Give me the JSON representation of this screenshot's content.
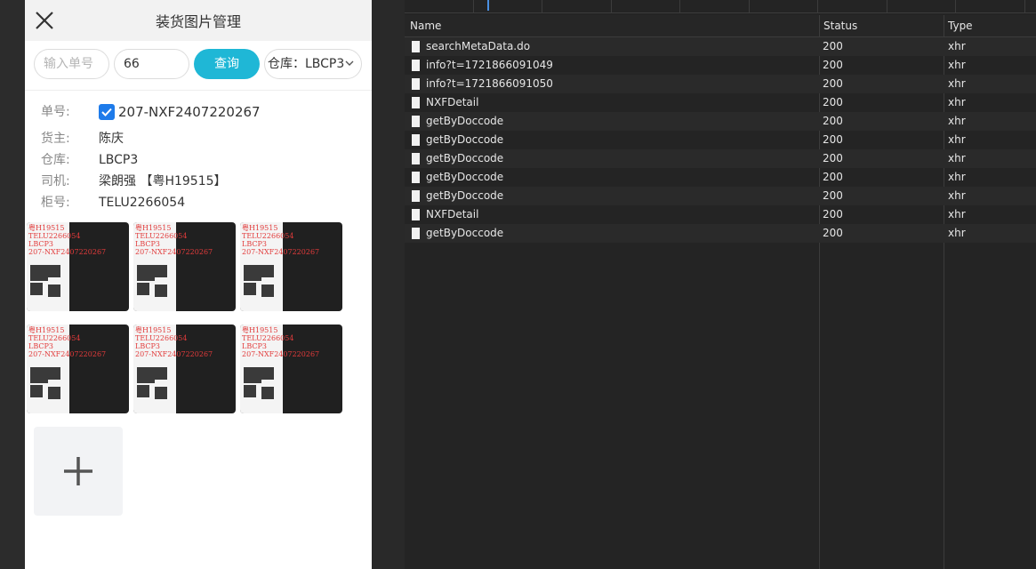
{
  "mobile": {
    "header_title": "装货图片管理",
    "search": {
      "order_placeholder": "输入单号",
      "number_value": "66",
      "query_label": "查询",
      "warehouse_selected": "仓库：LBCP3"
    },
    "details": {
      "order_label": "单号:",
      "order_value": "207-NXF2407220267",
      "owner_label": "货主:",
      "owner_value": "陈庆",
      "warehouse_label": "仓库:",
      "warehouse_value": "LBCP3",
      "driver_label": "司机:",
      "driver_value": "梁朗强 【粤H19515】",
      "container_label": "柜号:",
      "container_value": "TELU2266054"
    },
    "photos": [
      {
        "watermark": [
          "粤H19515",
          "TELU2266054",
          "LBCP3",
          "207-NXF2407220267"
        ]
      },
      {
        "watermark": [
          "粤H19515",
          "TELU2266054",
          "LBCP3",
          "207-NXF2407220267"
        ]
      },
      {
        "watermark": [
          "粤H19515",
          "TELU2266054",
          "LBCP3",
          "207-NXF2407220267"
        ]
      },
      {
        "watermark": [
          "粤H19515",
          "TELU2266054",
          "LBCP3",
          "207-NXF2407220267"
        ]
      },
      {
        "watermark": [
          "粤H19515",
          "TELU2266054",
          "LBCP3",
          "207-NXF2407220267"
        ]
      },
      {
        "watermark": [
          "粤H19515",
          "TELU2266054",
          "LBCP3",
          "207-NXF2407220267"
        ]
      }
    ]
  },
  "devtools": {
    "columns": {
      "name": "Name",
      "status": "Status",
      "type": "Type"
    },
    "requests": [
      {
        "name": "searchMetaData.do",
        "status": "200",
        "type": "xhr"
      },
      {
        "name": "info?t=1721866091049",
        "status": "200",
        "type": "xhr"
      },
      {
        "name": "info?t=1721866091050",
        "status": "200",
        "type": "xhr"
      },
      {
        "name": "NXFDetail",
        "status": "200",
        "type": "xhr"
      },
      {
        "name": "getByDoccode",
        "status": "200",
        "type": "xhr"
      },
      {
        "name": "getByDoccode",
        "status": "200",
        "type": "xhr"
      },
      {
        "name": "getByDoccode",
        "status": "200",
        "type": "xhr"
      },
      {
        "name": "getByDoccode",
        "status": "200",
        "type": "xhr"
      },
      {
        "name": "getByDoccode",
        "status": "200",
        "type": "xhr"
      },
      {
        "name": "NXFDetail",
        "status": "200",
        "type": "xhr"
      },
      {
        "name": "getByDoccode",
        "status": "200",
        "type": "xhr"
      }
    ]
  },
  "colors": {
    "accent": "#1fb7d6",
    "checkbox": "#1e7bea"
  }
}
